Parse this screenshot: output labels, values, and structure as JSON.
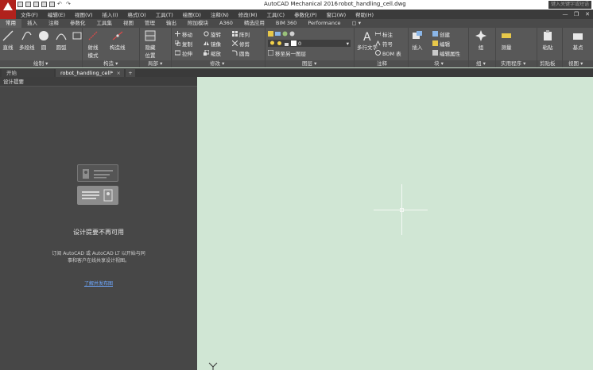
{
  "title_bar": {
    "app_title": "AutoCAD Mechanical 2016",
    "file_name": "robot_handling_cell.dwg",
    "search_placeholder": "键入关键字或短语"
  },
  "menu": [
    "文件(F)",
    "编辑(E)",
    "视图(V)",
    "插入(I)",
    "格式(O)",
    "工具(T)",
    "绘图(D)",
    "注释(N)",
    "修改(M)",
    "工具(C)",
    "参数化(P)",
    "窗口(W)",
    "帮助(H)"
  ],
  "window_controls": [
    "—",
    "❐",
    "✕"
  ],
  "ribbon_tabs": [
    {
      "label": "常用",
      "active": true
    },
    {
      "label": "插入"
    },
    {
      "label": "注释"
    },
    {
      "label": "参数化"
    },
    {
      "label": "工具集"
    },
    {
      "label": "视图"
    },
    {
      "label": "管理"
    },
    {
      "label": "输出"
    },
    {
      "label": "附加模块"
    },
    {
      "label": "A360"
    },
    {
      "label": "精选应用"
    },
    {
      "label": "BIM 360"
    },
    {
      "label": "Performance"
    },
    {
      "label": "▢ ▾"
    }
  ],
  "ribbon": {
    "draw": {
      "line": "直线",
      "polyline": "多段线",
      "circle": "圆",
      "arc": "圆弧",
      "panel": "绘制 ▾"
    },
    "construct": {
      "rays": "射线",
      "model": "模式",
      "construct_line": "构造线",
      "panel": "构造 ▾"
    },
    "layers_block": {
      "hide": "隐藏",
      "position": "位置",
      "panel": "局部 ▾"
    },
    "modify": {
      "move": "移动",
      "rotate": "旋转",
      "array": "阵列",
      "copy": "复制",
      "mirror": "镜像",
      "trim": "修剪",
      "stretch": "拉伸",
      "scale": "缩放",
      "fillet": "圆角",
      "panel": "修改 ▾"
    },
    "layer": {
      "current": "0",
      "match": "移至另一图层",
      "panel": "图层 ▾"
    },
    "annotation": {
      "multiline_text": "多行文字",
      "dimension": "标注",
      "symbol": "符号",
      "bom": "BOM 表",
      "panel": "注释"
    },
    "block": {
      "insert": "插入",
      "create": "创建",
      "edit": "编辑",
      "edit_attr": "编辑属性",
      "panel": "块 ▾"
    },
    "groups": {
      "group": "组",
      "panel": "组 ▾"
    },
    "utilities": {
      "measure": "测量",
      "panel": "实用程序 ▾"
    },
    "clipboard": {
      "paste": "粘贴",
      "panel": "剪贴板"
    },
    "view": {
      "base": "基点",
      "panel": "视图 ▾"
    }
  },
  "file_tabs": {
    "start": "开始",
    "doc": "robot_handling_cell*",
    "close": "×",
    "new": "+"
  },
  "design_feed": {
    "header": "设计提要",
    "title": "设计提要不再可用",
    "desc_line1": "订阅 AutoCAD 或 AutoCAD LT 以开始与同",
    "desc_line2": "事和客户在线共享设计视图。",
    "link": "了解并发布图"
  },
  "ucs_label": "Y"
}
